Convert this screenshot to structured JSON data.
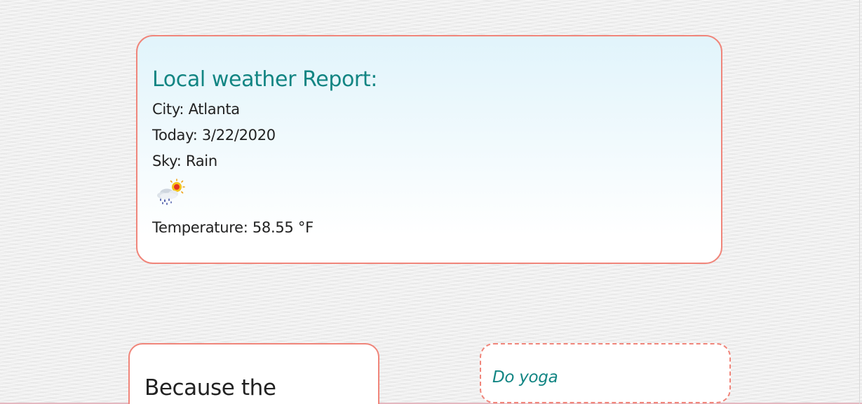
{
  "weather": {
    "title": "Local weather Report:",
    "city": "City: Atlanta",
    "today": "Today: 3/22/2020",
    "sky": "Sky: Rain",
    "icon": "rain-cloud-sun-icon",
    "temperature": "Temperature: 58.55 °F"
  },
  "note": {
    "text": "Because the"
  },
  "todo": {
    "text": "Do yoga"
  },
  "colors": {
    "accent": "#128583",
    "border": "#f0857a",
    "card_gradient_top": "#e1f4fb"
  }
}
